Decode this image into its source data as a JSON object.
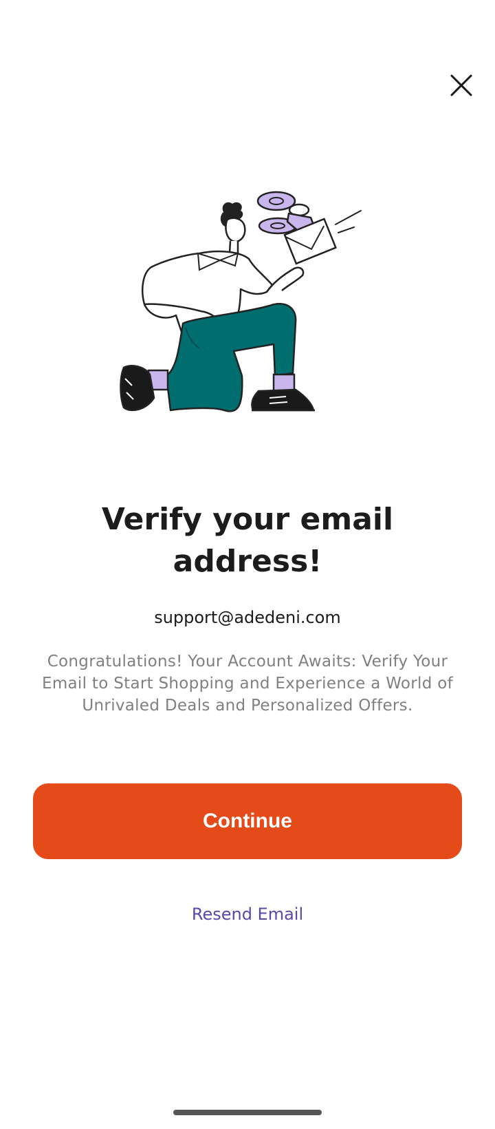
{
  "screen": {
    "close_icon": "close-icon",
    "title": "Verify your email address!",
    "email": "support@adedeni.com",
    "description": "Congratulations! Your Account Awaits: Verify Your Email to Start Shopping and Experience a World of Unrivaled Deals and Personalized Offers.",
    "continue_label": "Continue",
    "resend_label": "Resend Email"
  },
  "colors": {
    "primary": "#e54a19",
    "link": "#5a47a8",
    "illustration_teal": "#006d6f",
    "illustration_lavender": "#c9b6ec",
    "text_dark": "#1c1c1c",
    "text_muted": "#808080"
  }
}
